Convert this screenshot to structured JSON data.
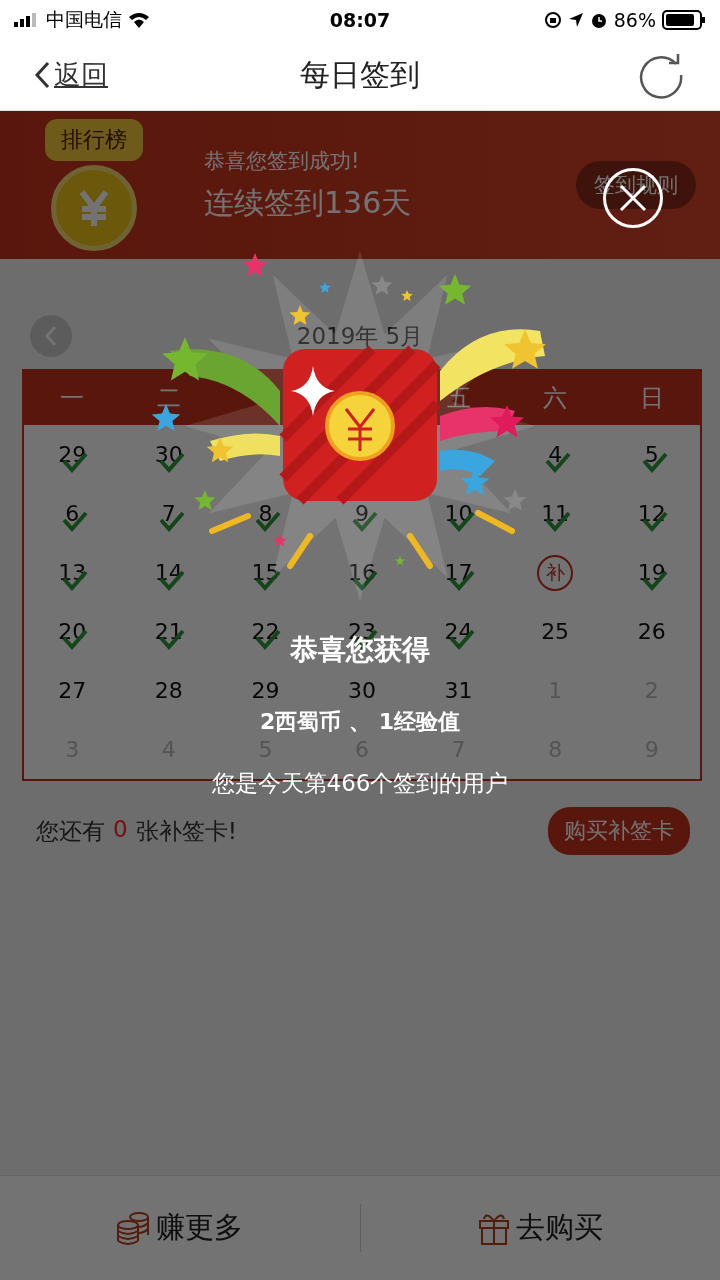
{
  "status_bar": {
    "carrier": "中国电信",
    "time": "08:07",
    "battery": "86%"
  },
  "nav": {
    "back": "返回",
    "title": "每日签到"
  },
  "banner": {
    "ranking": "排行榜",
    "message": "恭喜您签到成功!",
    "streak": "连续签到136天",
    "rules": "签到规则"
  },
  "calendar": {
    "month": "2019年 5月",
    "weekdays": [
      {
        "kind": "label",
        "text": "一"
      },
      {
        "kind": "label",
        "text": "二"
      },
      {
        "kind": "covered"
      },
      {
        "kind": "covered"
      },
      {
        "kind": "label",
        "text": "五"
      },
      {
        "kind": "label",
        "text": "六"
      },
      {
        "kind": "label",
        "text": "日"
      }
    ],
    "weeks": [
      [
        {
          "kind": "day",
          "text": "29",
          "checked": true
        },
        {
          "kind": "day",
          "text": "30",
          "checked": true
        },
        {
          "kind": "covered"
        },
        {
          "kind": "covered"
        },
        {
          "kind": "covered"
        },
        {
          "kind": "day",
          "text": "4",
          "checked": true
        },
        {
          "kind": "day",
          "text": "5",
          "checked": true
        }
      ],
      [
        {
          "kind": "day",
          "text": "6",
          "checked": true
        },
        {
          "kind": "day",
          "text": "7",
          "checked": true
        },
        {
          "kind": "day",
          "text": "8",
          "checked": true
        },
        {
          "kind": "day",
          "text": "9",
          "checked": true
        },
        {
          "kind": "day",
          "text": "10",
          "checked": true
        },
        {
          "kind": "day",
          "text": "11",
          "checked": true
        },
        {
          "kind": "day",
          "text": "12",
          "checked": true
        }
      ],
      [
        {
          "kind": "day",
          "text": "13",
          "checked": true
        },
        {
          "kind": "day",
          "text": "14",
          "checked": true
        },
        {
          "kind": "day",
          "text": "15",
          "checked": true
        },
        {
          "kind": "day",
          "text": "16",
          "checked": true
        },
        {
          "kind": "day",
          "text": "17",
          "checked": true
        },
        {
          "kind": "makeup",
          "text": "补",
          "checked": false
        },
        {
          "kind": "day",
          "text": "19",
          "checked": true
        }
      ],
      [
        {
          "kind": "day",
          "text": "20",
          "checked": true
        },
        {
          "kind": "day",
          "text": "21",
          "checked": true
        },
        {
          "kind": "day",
          "text": "22",
          "checked": true
        },
        {
          "kind": "day",
          "text": "23",
          "checked": true
        },
        {
          "kind": "day",
          "text": "24",
          "checked": true
        },
        {
          "kind": "day",
          "text": "25",
          "checked": false
        },
        {
          "kind": "day",
          "text": "26",
          "checked": false
        }
      ],
      [
        {
          "kind": "day",
          "text": "27",
          "checked": false
        },
        {
          "kind": "day",
          "text": "28",
          "checked": false
        },
        {
          "kind": "day",
          "text": "29",
          "checked": false
        },
        {
          "kind": "day",
          "text": "30",
          "checked": false
        },
        {
          "kind": "day",
          "text": "31",
          "checked": false
        },
        {
          "kind": "other",
          "text": "1",
          "checked": false
        },
        {
          "kind": "other",
          "text": "2",
          "checked": false
        }
      ],
      [
        {
          "kind": "other",
          "text": "3",
          "checked": false
        },
        {
          "kind": "other",
          "text": "4",
          "checked": false
        },
        {
          "kind": "other",
          "text": "5",
          "checked": false
        },
        {
          "kind": "other",
          "text": "6",
          "checked": false
        },
        {
          "kind": "other",
          "text": "7",
          "checked": false
        },
        {
          "kind": "other",
          "text": "8",
          "checked": false
        },
        {
          "kind": "other",
          "text": "9",
          "checked": false
        }
      ]
    ]
  },
  "makeup_cards": {
    "prefix": "您还有",
    "count": "0",
    "suffix": "张补签卡!",
    "buy": "购买补签卡"
  },
  "bottom_bar": [
    {
      "kind": "coins",
      "label": "赚更多"
    },
    {
      "kind": "gift",
      "label": "去购买"
    }
  ],
  "dialog": {
    "title": "恭喜您获得",
    "reward": "2西蜀币 、 1经验值",
    "rank": "您是今天第466个签到的用户"
  }
}
